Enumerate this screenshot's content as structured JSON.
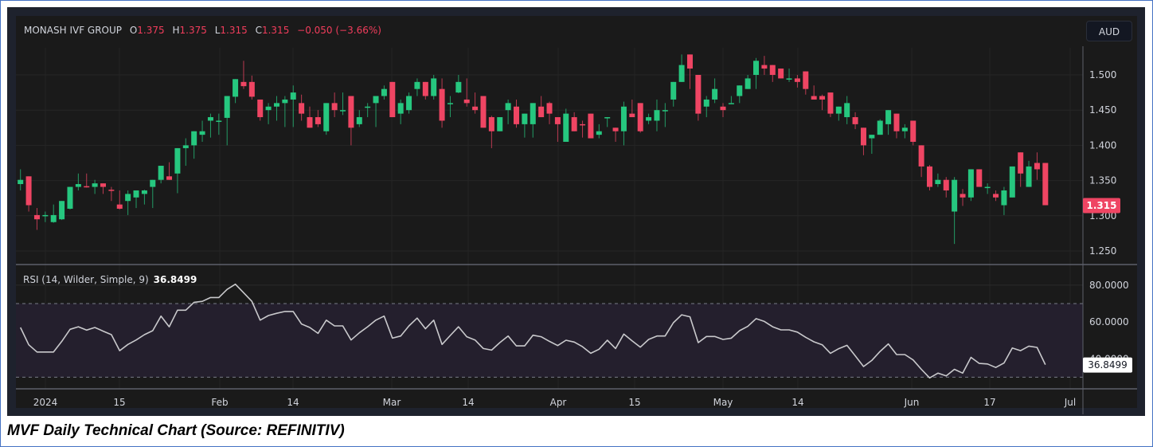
{
  "header": {
    "symbol": "MONASH IVF GROUP",
    "open_label": "O",
    "open": "1.375",
    "high_label": "H",
    "high": "1.375",
    "low_label": "L",
    "low": "1.315",
    "close_label": "C",
    "close": "1.315",
    "change": "−0.050 (−3.66%)"
  },
  "currency_button": "AUD",
  "last_price_tag": "1.315",
  "rsi": {
    "label": "RSI (14, Wilder, Simple, 9)",
    "value": "36.8499"
  },
  "caption": "MVF Daily Technical Chart (Source: REFINITIV)",
  "colors": {
    "up": "#26c77f",
    "down": "#ef4563",
    "rsi_line": "#c9c9cc",
    "rsi_band": "#241f2d"
  },
  "chart_data": [
    {
      "type": "candlestick",
      "title": "MONASH IVF GROUP daily",
      "ylabel": "AUD",
      "ylim": [
        1.23,
        1.54
      ],
      "y_ticks": [
        "1.500",
        "1.450",
        "1.400",
        "1.350",
        "1.300",
        "1.250"
      ],
      "x_ticks": [
        "2024",
        "15",
        "Feb",
        "14",
        "Mar",
        "14",
        "Apr",
        "15",
        "May",
        "14",
        "Jun",
        "17",
        "Jul"
      ],
      "grid": true,
      "ohlc": [
        [
          1.345,
          1.366,
          1.336,
          1.351
        ],
        [
          1.356,
          1.356,
          1.306,
          1.315
        ],
        [
          1.301,
          1.311,
          1.28,
          1.295
        ],
        [
          1.3,
          1.306,
          1.291,
          1.301
        ],
        [
          1.291,
          1.316,
          1.29,
          1.301
        ],
        [
          1.295,
          1.321,
          1.294,
          1.321
        ],
        [
          1.31,
          1.341,
          1.309,
          1.341
        ],
        [
          1.341,
          1.36,
          1.336,
          1.345
        ],
        [
          1.342,
          1.36,
          1.34,
          1.341
        ],
        [
          1.341,
          1.351,
          1.331,
          1.346
        ],
        [
          1.346,
          1.346,
          1.331,
          1.341
        ],
        [
          1.337,
          1.341,
          1.321,
          1.336
        ],
        [
          1.316,
          1.336,
          1.309,
          1.31
        ],
        [
          1.321,
          1.336,
          1.301,
          1.331
        ],
        [
          1.326,
          1.336,
          1.311,
          1.336
        ],
        [
          1.331,
          1.337,
          1.316,
          1.336
        ],
        [
          1.341,
          1.351,
          1.311,
          1.351
        ],
        [
          1.351,
          1.371,
          1.346,
          1.371
        ],
        [
          1.356,
          1.376,
          1.351,
          1.351
        ],
        [
          1.36,
          1.396,
          1.332,
          1.396
        ],
        [
          1.396,
          1.41,
          1.371,
          1.4
        ],
        [
          1.4,
          1.42,
          1.381,
          1.42
        ],
        [
          1.415,
          1.435,
          1.405,
          1.42
        ],
        [
          1.435,
          1.445,
          1.411,
          1.44
        ],
        [
          1.435,
          1.445,
          1.415,
          1.435
        ],
        [
          1.439,
          1.47,
          1.4,
          1.47
        ],
        [
          1.469,
          1.494,
          1.46,
          1.494
        ],
        [
          1.49,
          1.52,
          1.48,
          1.484
        ],
        [
          1.49,
          1.499,
          1.465,
          1.469
        ],
        [
          1.465,
          1.465,
          1.435,
          1.44
        ],
        [
          1.45,
          1.46,
          1.43,
          1.455
        ],
        [
          1.455,
          1.47,
          1.435,
          1.46
        ],
        [
          1.46,
          1.47,
          1.426,
          1.465
        ],
        [
          1.465,
          1.485,
          1.426,
          1.475
        ],
        [
          1.46,
          1.472,
          1.435,
          1.445
        ],
        [
          1.44,
          1.455,
          1.425,
          1.425
        ],
        [
          1.44,
          1.45,
          1.426,
          1.43
        ],
        [
          1.42,
          1.46,
          1.415,
          1.46
        ],
        [
          1.46,
          1.475,
          1.44,
          1.45
        ],
        [
          1.45,
          1.475,
          1.443,
          1.45
        ],
        [
          1.47,
          1.47,
          1.4,
          1.425
        ],
        [
          1.43,
          1.45,
          1.426,
          1.44
        ],
        [
          1.455,
          1.46,
          1.44,
          1.455
        ],
        [
          1.46,
          1.47,
          1.426,
          1.47
        ],
        [
          1.47,
          1.485,
          1.465,
          1.48
        ],
        [
          1.49,
          1.49,
          1.44,
          1.44
        ],
        [
          1.445,
          1.465,
          1.43,
          1.46
        ],
        [
          1.45,
          1.475,
          1.445,
          1.47
        ],
        [
          1.48,
          1.495,
          1.47,
          1.49
        ],
        [
          1.49,
          1.49,
          1.465,
          1.47
        ],
        [
          1.47,
          1.5,
          1.465,
          1.495
        ],
        [
          1.48,
          1.495,
          1.425,
          1.435
        ],
        [
          1.46,
          1.47,
          1.44,
          1.46
        ],
        [
          1.475,
          1.5,
          1.474,
          1.49
        ],
        [
          1.465,
          1.495,
          1.455,
          1.46
        ],
        [
          1.455,
          1.475,
          1.445,
          1.45
        ],
        [
          1.47,
          1.47,
          1.425,
          1.425
        ],
        [
          1.44,
          1.442,
          1.396,
          1.42
        ],
        [
          1.42,
          1.44,
          1.42,
          1.44
        ],
        [
          1.45,
          1.465,
          1.43,
          1.46
        ],
        [
          1.455,
          1.465,
          1.425,
          1.43
        ],
        [
          1.43,
          1.445,
          1.411,
          1.445
        ],
        [
          1.43,
          1.46,
          1.411,
          1.46
        ],
        [
          1.455,
          1.47,
          1.44,
          1.44
        ],
        [
          1.46,
          1.462,
          1.43,
          1.445
        ],
        [
          1.44,
          1.44,
          1.405,
          1.43
        ],
        [
          1.405,
          1.452,
          1.405,
          1.445
        ],
        [
          1.44,
          1.447,
          1.42,
          1.42
        ],
        [
          1.43,
          1.435,
          1.411,
          1.429
        ],
        [
          1.445,
          1.445,
          1.41,
          1.41
        ],
        [
          1.415,
          1.43,
          1.41,
          1.42
        ],
        [
          1.44,
          1.44,
          1.426,
          1.44
        ],
        [
          1.425,
          1.425,
          1.405,
          1.42
        ],
        [
          1.42,
          1.462,
          1.4,
          1.455
        ],
        [
          1.445,
          1.465,
          1.44,
          1.44
        ],
        [
          1.46,
          1.46,
          1.418,
          1.42
        ],
        [
          1.435,
          1.445,
          1.43,
          1.44
        ],
        [
          1.435,
          1.465,
          1.42,
          1.45
        ],
        [
          1.45,
          1.46,
          1.426,
          1.45
        ],
        [
          1.465,
          1.49,
          1.455,
          1.49
        ],
        [
          1.49,
          1.529,
          1.49,
          1.514
        ],
        [
          1.529,
          1.529,
          1.48,
          1.509
        ],
        [
          1.5,
          1.5,
          1.435,
          1.445
        ],
        [
          1.455,
          1.47,
          1.44,
          1.465
        ],
        [
          1.465,
          1.495,
          1.46,
          1.48
        ],
        [
          1.455,
          1.46,
          1.44,
          1.45
        ],
        [
          1.46,
          1.47,
          1.46,
          1.46
        ],
        [
          1.47,
          1.485,
          1.46,
          1.485
        ],
        [
          1.48,
          1.5,
          1.48,
          1.495
        ],
        [
          1.5,
          1.524,
          1.48,
          1.52
        ],
        [
          1.514,
          1.527,
          1.5,
          1.509
        ],
        [
          1.514,
          1.514,
          1.49,
          1.5
        ],
        [
          1.509,
          1.509,
          1.495,
          1.495
        ],
        [
          1.495,
          1.509,
          1.49,
          1.495
        ],
        [
          1.495,
          1.5,
          1.482,
          1.49
        ],
        [
          1.505,
          1.505,
          1.472,
          1.48
        ],
        [
          1.47,
          1.485,
          1.465,
          1.465
        ],
        [
          1.47,
          1.472,
          1.45,
          1.465
        ],
        [
          1.475,
          1.475,
          1.44,
          1.445
        ],
        [
          1.445,
          1.455,
          1.435,
          1.455
        ],
        [
          1.44,
          1.47,
          1.43,
          1.46
        ],
        [
          1.44,
          1.447,
          1.423,
          1.43
        ],
        [
          1.425,
          1.425,
          1.386,
          1.4
        ],
        [
          1.41,
          1.415,
          1.388,
          1.415
        ],
        [
          1.415,
          1.437,
          1.415,
          1.435
        ],
        [
          1.43,
          1.45,
          1.415,
          1.45
        ],
        [
          1.445,
          1.445,
          1.41,
          1.42
        ],
        [
          1.42,
          1.43,
          1.41,
          1.425
        ],
        [
          1.435,
          1.435,
          1.4,
          1.405
        ],
        [
          1.4,
          1.4,
          1.355,
          1.37
        ],
        [
          1.37,
          1.372,
          1.336,
          1.341
        ],
        [
          1.345,
          1.36,
          1.341,
          1.351
        ],
        [
          1.351,
          1.355,
          1.326,
          1.336
        ],
        [
          1.306,
          1.355,
          1.26,
          1.351
        ],
        [
          1.331,
          1.338,
          1.314,
          1.326
        ],
        [
          1.326,
          1.366,
          1.321,
          1.366
        ],
        [
          1.366,
          1.366,
          1.341,
          1.341
        ],
        [
          1.341,
          1.346,
          1.331,
          1.341
        ],
        [
          1.331,
          1.336,
          1.321,
          1.326
        ],
        [
          1.315,
          1.341,
          1.301,
          1.336
        ],
        [
          1.326,
          1.37,
          1.326,
          1.37
        ],
        [
          1.39,
          1.39,
          1.341,
          1.36
        ],
        [
          1.341,
          1.378,
          1.341,
          1.37
        ],
        [
          1.375,
          1.39,
          1.351,
          1.366
        ],
        [
          1.375,
          1.375,
          1.315,
          1.315
        ]
      ]
    },
    {
      "type": "line",
      "title": "RSI (14, Wilder, Simple, 9)",
      "ylim": [
        20,
        90
      ],
      "y_ticks": [
        "80.0000",
        "60.0000",
        "40.0000"
      ],
      "bands": [
        30,
        70
      ],
      "values": [
        57.0,
        47.6,
        43.7,
        43.7,
        43.7,
        49.5,
        56.0,
        57.4,
        55.6,
        57.0,
        55.0,
        53.1,
        44.4,
        47.8,
        50.2,
        53.1,
        55.3,
        63.2,
        57.4,
        66.4,
        66.4,
        70.7,
        71.2,
        73.3,
        73.3,
        77.7,
        80.5,
        75.9,
        71.2,
        61.0,
        63.5,
        64.7,
        65.7,
        65.7,
        58.9,
        57.0,
        53.8,
        61.0,
        57.9,
        57.9,
        50.2,
        54.1,
        57.4,
        61.0,
        63.2,
        51.2,
        52.4,
        57.9,
        62.1,
        56.3,
        61.0,
        47.8,
        52.7,
        57.4,
        52.0,
        50.2,
        45.6,
        44.7,
        48.8,
        52.4,
        47.0,
        47.0,
        52.8,
        52.0,
        49.5,
        47.2,
        50.1,
        49.1,
        46.6,
        43.0,
        45.2,
        50.1,
        45.6,
        53.4,
        49.8,
        46.3,
        50.5,
        52.4,
        52.4,
        59.6,
        63.9,
        62.8,
        48.8,
        52.1,
        52.1,
        50.5,
        51.2,
        55.3,
        57.6,
        61.8,
        60.3,
        57.4,
        55.7,
        55.7,
        54.5,
        51.7,
        49.2,
        47.6,
        43.0,
        45.5,
        47.3,
        41.6,
        35.8,
        39.1,
        44.0,
        48.1,
        42.3,
        42.3,
        39.4,
        34.3,
        29.6,
        32.2,
        30.7,
        34.3,
        32.2,
        40.8,
        37.5,
        37.2,
        35.3,
        37.7,
        45.9,
        44.4,
        46.9,
        46.2,
        36.85
      ]
    }
  ]
}
